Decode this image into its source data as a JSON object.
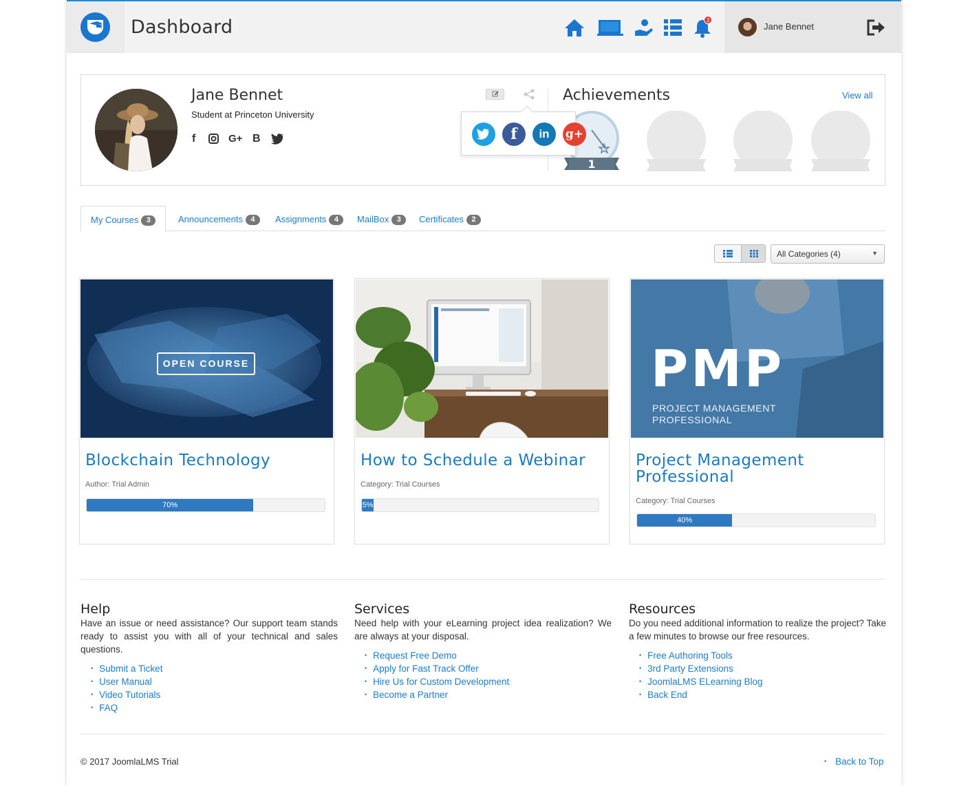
{
  "header": {
    "title": "Dashboard",
    "notification_count": "3",
    "user_name": "Jane Bennet",
    "icons": [
      "home-icon",
      "courses-icon",
      "hand-icon",
      "list-icon",
      "bell-icon",
      "logout-icon"
    ],
    "accent_color": "#1b76cf"
  },
  "profile": {
    "name": "Jane Bennet",
    "subtitle": "Student at Princeton University",
    "social_labels": {
      "facebook": "f",
      "google": "G+",
      "b": "B"
    },
    "achievements_title": "Achievements",
    "view_all": "View all",
    "medal_number": "1",
    "share_labels": {
      "linkedin": "in",
      "google_plus": "g+"
    }
  },
  "tabs": [
    {
      "label": "My Courses",
      "count": "3"
    },
    {
      "label": "Announcements",
      "count": "4"
    },
    {
      "label": "Assignments",
      "count": "4"
    },
    {
      "label": "MailBox",
      "count": "3"
    },
    {
      "label": "Certificates",
      "count": "2"
    }
  ],
  "filters": {
    "category_selected": "All Categories (4)"
  },
  "courses": [
    {
      "title": "Blockchain Technology",
      "meta": "Author: Trial Admin",
      "progress": 70,
      "progress_label": "70%",
      "overlay_button": "OPEN COURSE"
    },
    {
      "title": "How to Schedule a Webinar",
      "meta": "Category: Trial Courses",
      "progress": 5,
      "progress_label": "5%"
    },
    {
      "title": "Project Management Professional",
      "meta": "Category: Trial Courses",
      "progress": 40,
      "progress_label": "40%",
      "image_big": "PMP",
      "image_sub1": "PROJECT MANAGEMENT",
      "image_sub2": "PROFESSIONAL"
    }
  ],
  "footer": {
    "help": {
      "title": "Help",
      "text": "Have an issue or need assistance? Our support team stands ready to assist you with all of your technical and sales questions.",
      "links": [
        "Submit a Ticket",
        "User Manual",
        "Video Tutorials",
        "FAQ"
      ]
    },
    "services": {
      "title": "Services",
      "text": "Need help with your eLearning project idea realization? We are always at your disposal.",
      "links": [
        "Request Free Demo",
        "Apply for Fast Track Offer",
        "Hire Us for Custom Development",
        "Become a Partner"
      ]
    },
    "resources": {
      "title": "Resources",
      "text": "Do you need additional information to realize the project? Take a few minutes to browse our free resources.",
      "links": [
        "Free Authoring Tools",
        "3rd Party Extensions",
        "JoomlaLMS ELearning Blog",
        "Back End"
      ]
    },
    "copyright": "© 2017 JoomlaLMS Trial",
    "back_to_top": "Back to Top"
  }
}
